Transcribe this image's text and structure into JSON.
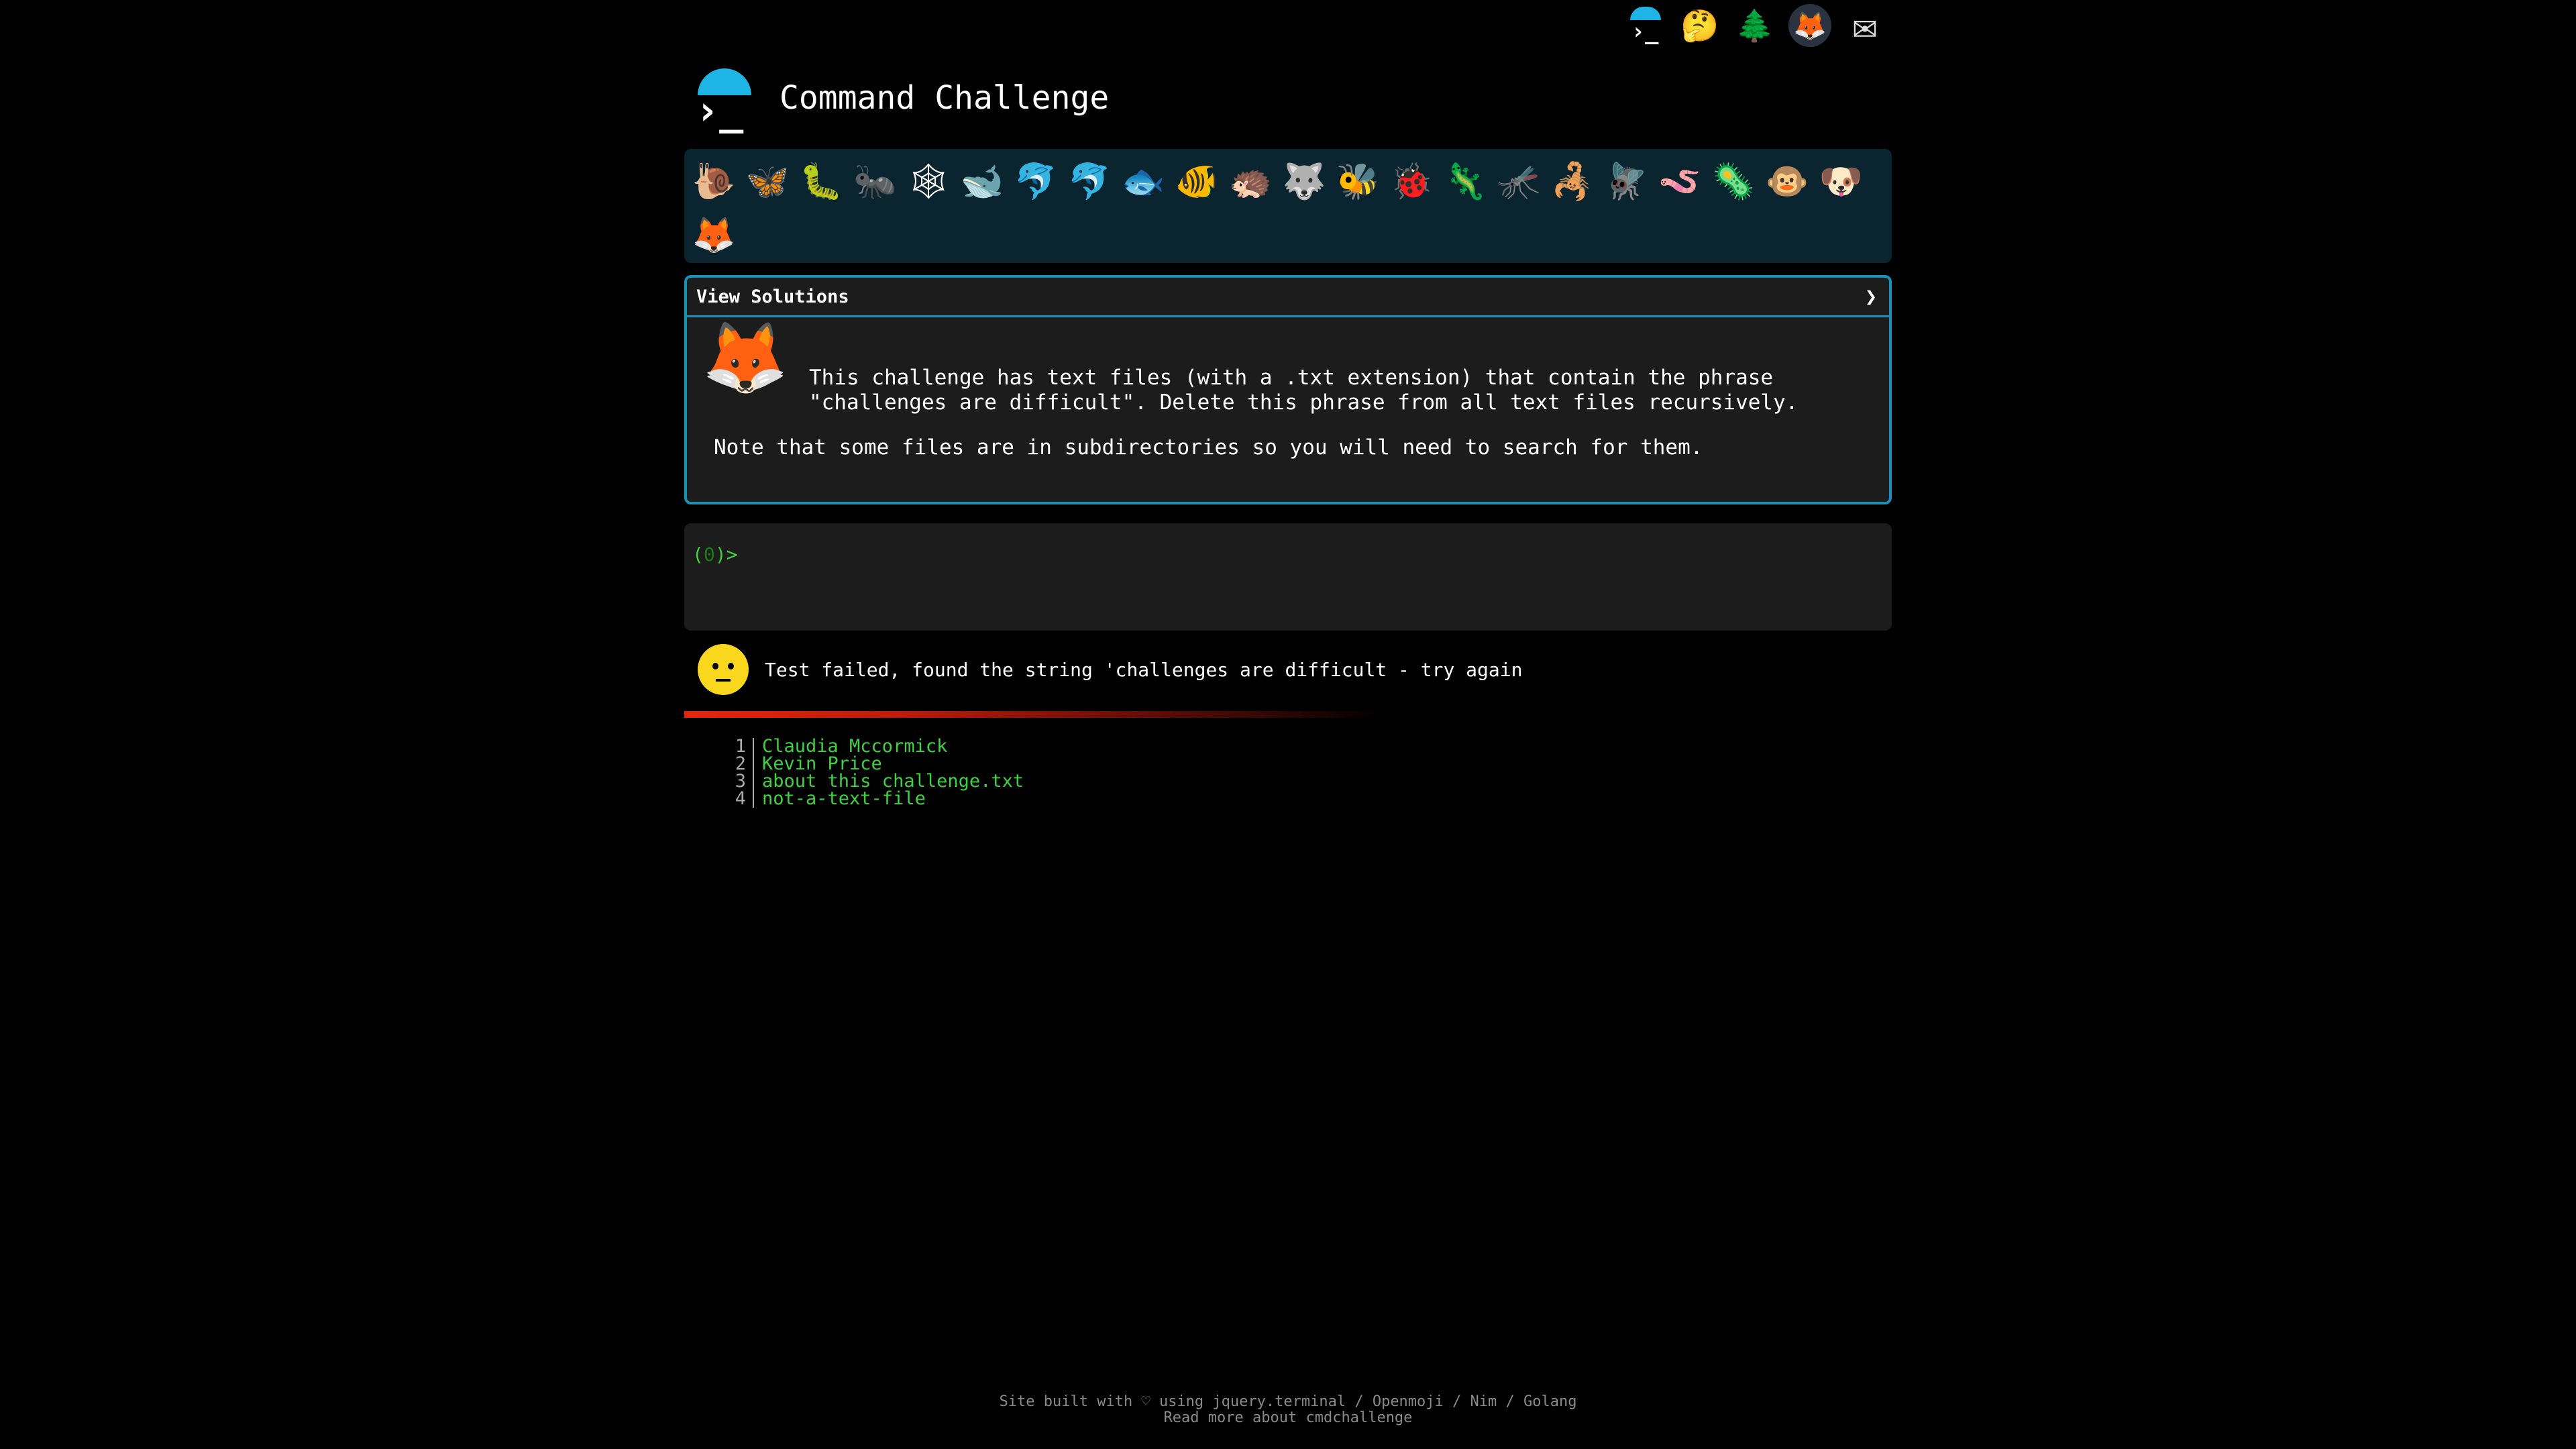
{
  "top_icons": [
    {
      "name": "cmdchallenge-icon",
      "glyph": "›_"
    },
    {
      "name": "thinking-face-icon",
      "glyph": "🤔"
    },
    {
      "name": "tree-icon",
      "glyph": "🌲"
    },
    {
      "name": "gitlab-icon",
      "glyph": "🦊"
    },
    {
      "name": "mail-icon",
      "glyph": "✉"
    }
  ],
  "header": {
    "logo_glyph": "›_",
    "title": "Command Challenge"
  },
  "emoji_strip": [
    "🐌",
    "🦋",
    "🐛",
    "🐜",
    "🕸",
    "🐋",
    "🐬",
    "🐬",
    "🐟",
    "🐠",
    "🦔",
    "🐺",
    "🐝",
    "🐞",
    "🦎",
    "🦟",
    "🦂",
    "🪰",
    "🪱",
    "🦠",
    "🐵",
    "🐶",
    "🦊"
  ],
  "panel": {
    "header_label": "View Solutions",
    "chevron": "❯",
    "fox_glyph": "🦊",
    "description_line1": "This challenge has text files (with a .txt extension) that contain the phrase",
    "description_line2": "\"challenges are difficult\". Delete this phrase from all text files recursively.",
    "note": "Note that some files are in subdirectories so you will need to search for them."
  },
  "terminal": {
    "prompt_open": "(",
    "prompt_num": "0",
    "prompt_close": ")>"
  },
  "result": {
    "message": "Test failed, found the string 'challenges are difficult - try again"
  },
  "progress": {
    "fraction": 0.58
  },
  "files": [
    {
      "line": "1",
      "name": "Claudia Mccormick"
    },
    {
      "line": "2",
      "name": "Kevin Price"
    },
    {
      "line": "3",
      "name": "about this challenge.txt"
    },
    {
      "line": "4",
      "name": "not-a-text-file"
    }
  ],
  "footer": {
    "line1": "Site built with ♡ using jquery.terminal / Openmoji / Nim / Golang",
    "line2": "Read more about cmdchallenge"
  }
}
